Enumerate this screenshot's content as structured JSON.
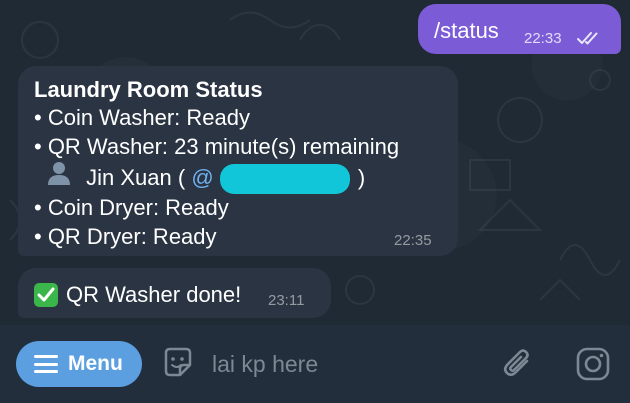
{
  "conversation": {
    "outgoing": {
      "text": "/status",
      "time": "22:33",
      "status_icon": "double-check-icon"
    },
    "status_message": {
      "title": "Laundry Room Status",
      "lines": [
        "• Coin Washer: Ready",
        "• QR Washer: 23 minute(s) remaining"
      ],
      "user_icon": "person-silhouette-icon",
      "user_name": "Jin Xuan (",
      "mention_prefix": "@",
      "mention_close": ")",
      "lines_after": [
        "• Coin Dryer: Ready",
        "• QR Dryer: Ready"
      ],
      "time": "22:35"
    },
    "done_message": {
      "icon": "check-mark-button-icon",
      "text": "QR Washer done!",
      "time": "23:11"
    }
  },
  "composer": {
    "menu_label": "Menu",
    "placeholder": "lai kp here",
    "icons": [
      "hamburger-icon",
      "sticker-icon",
      "paperclip-icon",
      "camera-icon"
    ]
  },
  "colors": {
    "outgoing_bubble": "#7b5cd6",
    "incoming_bubble": "#2a3442",
    "menu_button": "#5b9fe0",
    "mention": "#6fb1ef",
    "redaction": "#11c6d8"
  }
}
